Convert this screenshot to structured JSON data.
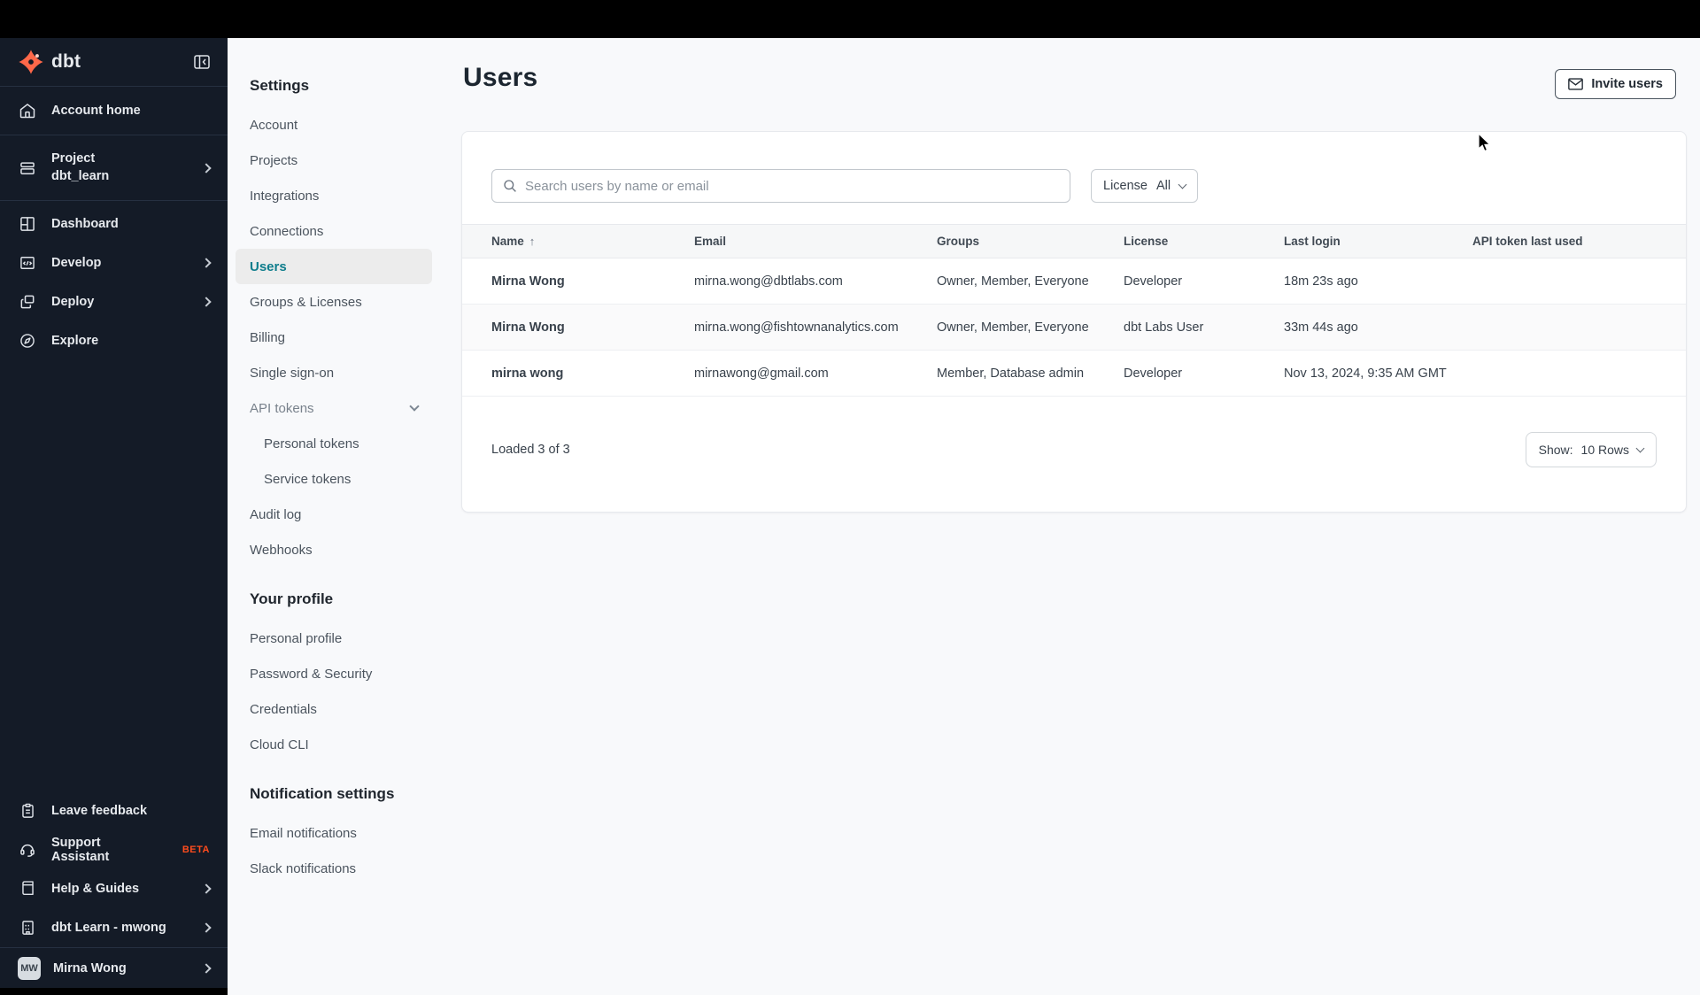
{
  "sidebar": {
    "logo_text": "dbt",
    "items": [
      {
        "label": "Account home",
        "icon": "home-icon"
      },
      {
        "label": "Project",
        "sublabel": "dbt_learn",
        "icon": "project-icon",
        "chevron": true
      },
      {
        "label": "Dashboard",
        "icon": "dashboard-icon"
      },
      {
        "label": "Develop",
        "icon": "code-icon",
        "chevron": true
      },
      {
        "label": "Deploy",
        "icon": "deploy-icon",
        "chevron": true
      },
      {
        "label": "Explore",
        "icon": "compass-icon"
      }
    ],
    "footer_items": [
      {
        "label": "Leave feedback",
        "icon": "clipboard-icon"
      },
      {
        "label": "Support Assistant",
        "badge": "BETA",
        "icon": "headset-icon"
      },
      {
        "label": "Help & Guides",
        "icon": "book-icon",
        "chevron": true
      },
      {
        "label": "dbt Learn - mwong",
        "icon": "building-icon",
        "chevron": true
      }
    ],
    "user": {
      "initials": "MW",
      "name": "Mirna Wong"
    }
  },
  "settings_nav": {
    "title": "Settings",
    "items": [
      {
        "label": "Account"
      },
      {
        "label": "Projects"
      },
      {
        "label": "Integrations"
      },
      {
        "label": "Connections"
      },
      {
        "label": "Users",
        "active": true
      },
      {
        "label": "Groups & Licenses"
      },
      {
        "label": "Billing"
      },
      {
        "label": "Single sign-on"
      },
      {
        "label": "API tokens",
        "expandable": true
      },
      {
        "label": "Personal tokens",
        "sub": true
      },
      {
        "label": "Service tokens",
        "sub": true
      },
      {
        "label": "Audit log"
      },
      {
        "label": "Webhooks"
      }
    ],
    "profile_title": "Your profile",
    "profile_items": [
      {
        "label": "Personal profile"
      },
      {
        "label": "Password & Security"
      },
      {
        "label": "Credentials"
      },
      {
        "label": "Cloud CLI"
      }
    ],
    "notification_title": "Notification settings",
    "notification_items": [
      {
        "label": "Email notifications"
      },
      {
        "label": "Slack notifications"
      }
    ]
  },
  "main": {
    "title": "Users",
    "invite_button": "Invite users",
    "search_placeholder": "Search users by name or email",
    "license_filter": {
      "label": "License",
      "value": "All"
    },
    "table": {
      "columns": [
        "Name",
        "Email",
        "Groups",
        "License",
        "Last login",
        "API token last used"
      ],
      "sorted_column": "Name",
      "sort_direction": "asc",
      "rows": [
        {
          "name": "Mirna Wong",
          "email": "mirna.wong@dbtlabs.com",
          "groups": "Owner, Member, Everyone",
          "license": "Developer",
          "last_login": "18m 23s ago",
          "api_token_last_used": ""
        },
        {
          "name": "Mirna Wong",
          "email": "mirna.wong@fishtownanalytics.com",
          "groups": "Owner, Member, Everyone",
          "license": "dbt Labs User",
          "last_login": "33m 44s ago",
          "api_token_last_used": ""
        },
        {
          "name": "mirna wong",
          "email": "mirnawong@gmail.com",
          "groups": "Member, Database admin",
          "license": "Developer",
          "last_login": "Nov 13, 2024, 9:35 AM GMT",
          "api_token_last_used": ""
        }
      ]
    },
    "footer": {
      "loaded_text": "Loaded 3 of 3",
      "show_label": "Show:",
      "show_value": "10 Rows"
    }
  },
  "colors": {
    "accent_teal": "#0e7d8c",
    "sidebar_bg": "#141b27",
    "logo_orange": "#ff6849",
    "beta_orange": "#ff4c1d",
    "page_bg": "#f8f9fb",
    "active_nav_bg": "#ececec"
  }
}
